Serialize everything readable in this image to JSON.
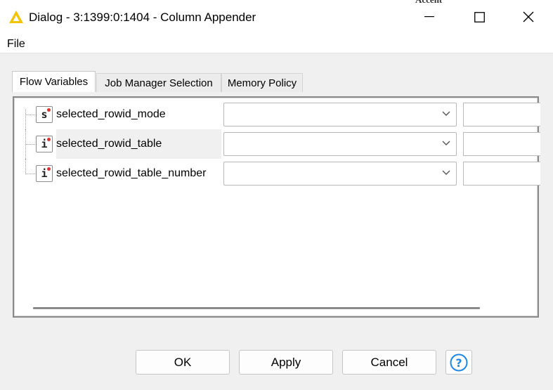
{
  "window": {
    "title": "Dialog - 3:1399:0:1404 - Column Appender",
    "background_peek_text": "Accent",
    "controls": {
      "minimize": "minimize-icon",
      "maximize": "maximize-icon",
      "close": "close-icon"
    },
    "accent_color": "#f5c400"
  },
  "menu": {
    "file_label": "File"
  },
  "tabs": [
    {
      "label": "Flow Variables",
      "active": true
    },
    {
      "label": "Job Manager Selection",
      "active": false
    },
    {
      "label": "Memory Policy",
      "active": false
    }
  ],
  "variables": [
    {
      "type_glyph": "s",
      "name": "selected_rowid_mode",
      "selected_value": "",
      "text_value": ""
    },
    {
      "type_glyph": "i",
      "name": "selected_rowid_table",
      "selected_value": "",
      "text_value": ""
    },
    {
      "type_glyph": "i",
      "name": "selected_rowid_table_number",
      "selected_value": "",
      "text_value": ""
    }
  ],
  "buttons": {
    "ok": "OK",
    "apply": "Apply",
    "cancel": "Cancel",
    "help_icon": "help-icon"
  },
  "colors": {
    "help_accent": "#1e88e5",
    "flag_dot": "#e03030"
  }
}
